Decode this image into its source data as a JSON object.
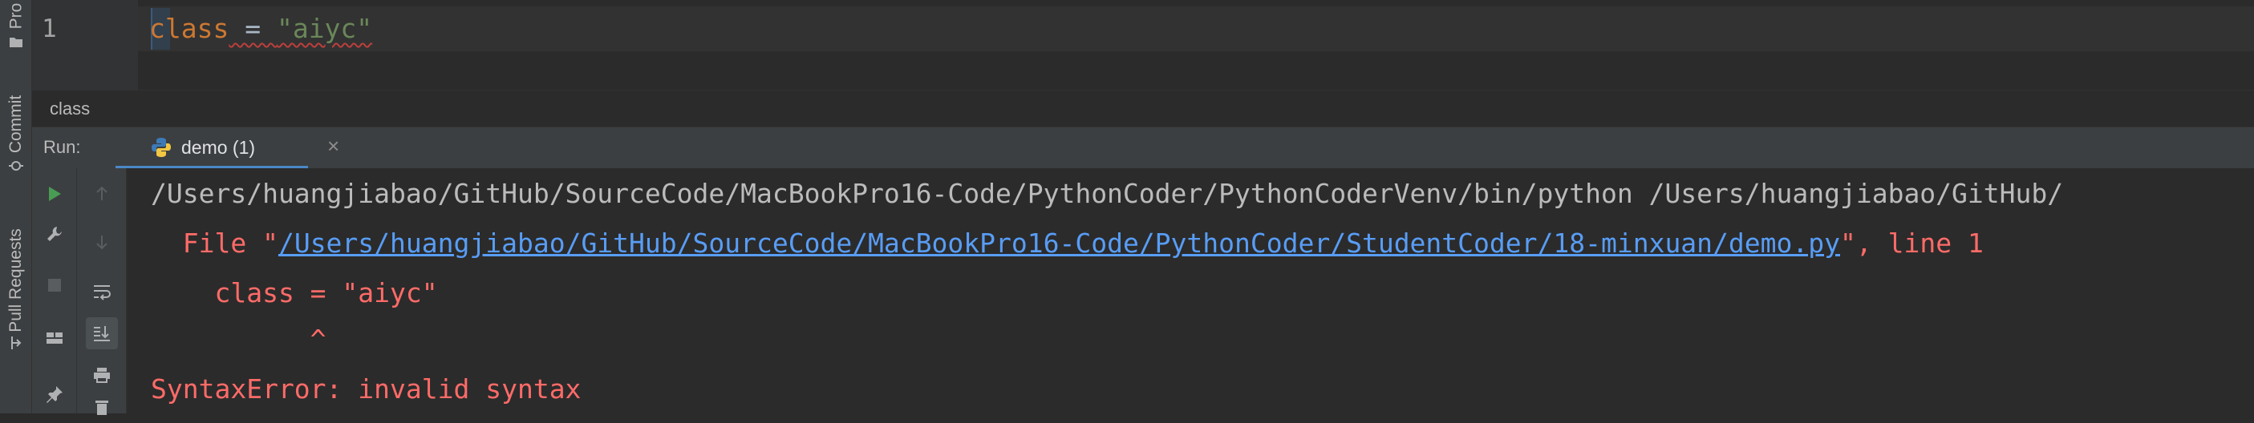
{
  "sidebar": {
    "tabs": [
      {
        "label": "Pro",
        "icon": "folder-icon"
      },
      {
        "label": "Commit",
        "icon": "commit-icon"
      },
      {
        "label": "Pull Requests",
        "icon": "pull-request-icon"
      }
    ]
  },
  "editor": {
    "line_number": "1",
    "code": {
      "keyword": "class",
      "operator": " = ",
      "string": "\"aiyc\""
    }
  },
  "breadcrumb": {
    "item": "class"
  },
  "run_panel": {
    "label": "Run:",
    "tab": {
      "name": "demo (1)",
      "icon": "python-icon",
      "close": "×"
    },
    "toolbar": [
      "run-icon",
      "up-arrow-icon",
      "wrench-icon",
      "down-arrow-icon",
      "stop-icon",
      "soft-wrap-icon",
      "layout-icon",
      "scroll-to-end-icon",
      "pin-icon",
      "print-icon",
      "trash-icon"
    ]
  },
  "console": {
    "line1": "/Users/huangjiabao/GitHub/SourceCode/MacBookPro16-Code/PythonCoder/PythonCoderVenv/bin/python /Users/huangjiabao/GitHub/",
    "line2_prefix": "  File \"",
    "line2_link": "/Users/huangjiabao/GitHub/SourceCode/MacBookPro16-Code/PythonCoder/StudentCoder/18-minxuan/demo.py",
    "line2_suffix": "\", line 1",
    "line3": "    class = \"aiyc\"",
    "line4": "          ^",
    "line5": "SyntaxError: invalid syntax"
  },
  "colors": {
    "accent": "#4a88c7",
    "error": "#ff6b68",
    "link": "#589df6",
    "keyword": "#cc7832",
    "string": "#6a8759"
  }
}
